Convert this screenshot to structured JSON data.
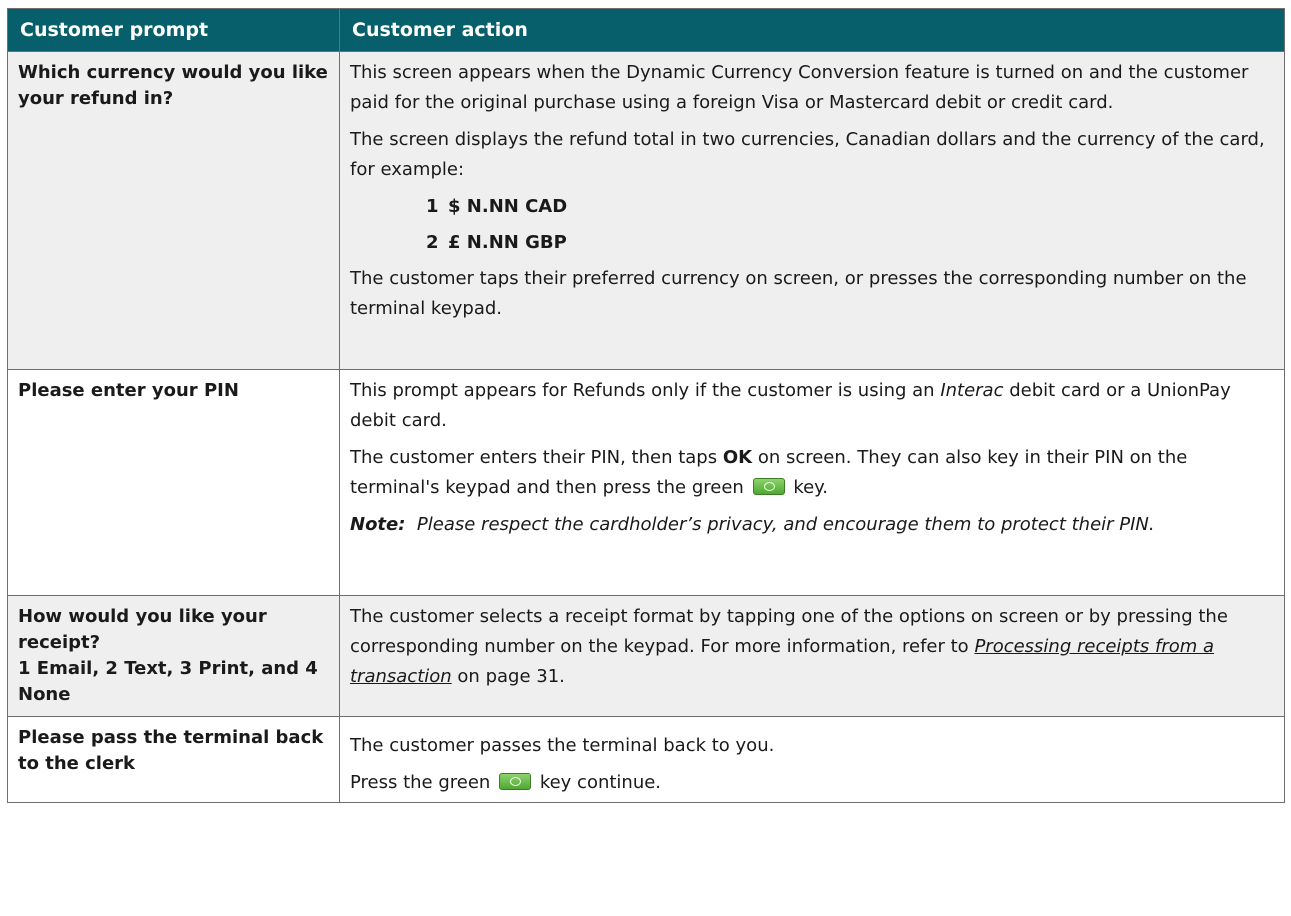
{
  "headers": {
    "col1": "Customer prompt",
    "col2": "Customer action"
  },
  "rows": [
    {
      "prompt": "Which currency would you like your refund in?",
      "p1": "This screen appears when the Dynamic Currency Conversion feature is turned on and the customer paid for the original purchase using a foreign Visa or Mastercard debit or credit card.",
      "p2": "The screen displays the refund total in two currencies, Canadian dollars and the currency of the card, for example:",
      "opt1_num": "1",
      "opt1_val": "$ N.NN CAD",
      "opt2_num": "2",
      "opt2_val": "£ N.NN GBP",
      "p3": "The customer taps their preferred currency on screen, or presses the corresponding number on the terminal keypad."
    },
    {
      "prompt": "Please enter your PIN",
      "p1_pre": "This prompt appears for Refunds only if the customer is using an",
      "p1_interac": "Interac",
      "p1_post": "debit card or a UnionPay debit card.",
      "p2_pre": "The customer enters their PIN, then taps",
      "p2_ok": "OK",
      "p2_mid": "on screen.  They can also key in their PIN on the terminal's keypad and then press the green",
      "p2_post": "key.",
      "note_label": "Note:",
      "note_text": "Please respect the cardholder’s privacy, and encourage them to protect their PIN."
    },
    {
      "prompt_line1": "How would you like your receipt?",
      "prompt_line2": "1 Email, 2 Text, 3 Print, and 4 None",
      "p1_pre": "The customer selects a receipt format by tapping one of the options on screen or by pressing the corresponding number on the keypad. For more information, refer to",
      "p1_link": "Processing receipts from a transaction",
      "p1_post": "on page 31."
    },
    {
      "prompt": "Please pass the terminal back to the clerk",
      "p1": "The customer passes the terminal back to you.",
      "p2_pre": "Press the green",
      "p2_post": "key continue."
    }
  ],
  "icons": {
    "key": "green-ok-key-icon",
    "key_color": "#5cb83c"
  },
  "colors": {
    "header_bg": "#075f6b",
    "row_alt_bg": "#efefef"
  }
}
